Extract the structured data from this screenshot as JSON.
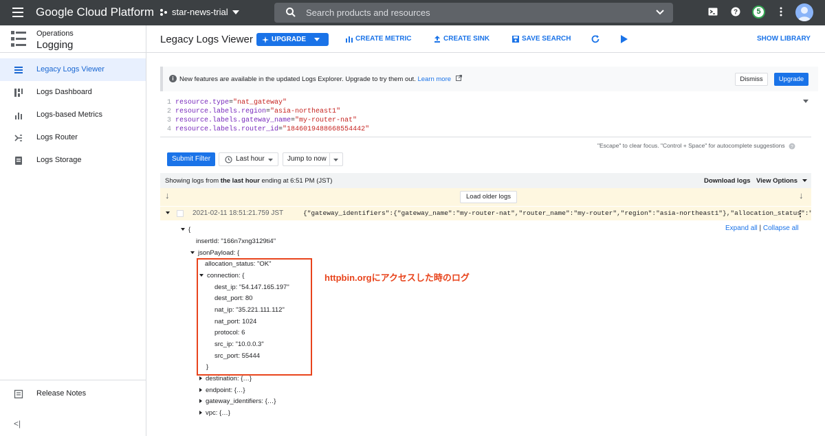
{
  "topbar": {
    "brand": "Google Cloud Platform",
    "project": "star-news-trial",
    "search_placeholder": "Search products and resources",
    "notification_count": "5"
  },
  "sidebar": {
    "section_sub": "Operations",
    "section_title": "Logging",
    "items": [
      {
        "label": "Legacy Logs Viewer",
        "icon": "list-icon",
        "active": true
      },
      {
        "label": "Logs Dashboard",
        "icon": "dashboard-icon",
        "active": false
      },
      {
        "label": "Logs-based Metrics",
        "icon": "bar-chart-icon",
        "active": false
      },
      {
        "label": "Logs Router",
        "icon": "router-icon",
        "active": false
      },
      {
        "label": "Logs Storage",
        "icon": "storage-icon",
        "active": false
      }
    ],
    "release_notes": "Release Notes",
    "collapse": "<|"
  },
  "toolbar": {
    "title": "Legacy Logs Viewer",
    "upgrade": "UPGRADE",
    "create_metric": "CREATE METRIC",
    "create_sink": "CREATE SINK",
    "save_search": "SAVE SEARCH",
    "show_library": "SHOW LIBRARY"
  },
  "banner": {
    "text": "New features are available in the updated Logs Explorer. Upgrade to try them out.",
    "link": "Learn more",
    "dismiss": "Dismiss",
    "upgrade": "Upgrade"
  },
  "query": {
    "lines": [
      {
        "num": "1",
        "key": "resource.type",
        "value": "\"nat_gateway\""
      },
      {
        "num": "2",
        "key": "resource.labels.region",
        "value": "\"asia-northeast1\""
      },
      {
        "num": "3",
        "key": "resource.labels.gateway_name",
        "value": "\"my-router-nat\""
      },
      {
        "num": "4",
        "key": "resource.labels.router_id",
        "value": "\"1846019488668554442\""
      }
    ],
    "hint": "\"Escape\" to clear focus. \"Control + Space\" for autocomplete suggestions"
  },
  "controls": {
    "submit": "Submit Filter",
    "time_range": "Last hour",
    "jump": "Jump to now"
  },
  "status": {
    "prefix": "Showing logs from ",
    "bold": "the last hour",
    "suffix": " ending at 6:51 PM (JST)",
    "download": "Download logs",
    "view_options": "View Options"
  },
  "older": {
    "load_older": "Load older logs"
  },
  "entry": {
    "timestamp": "2021-02-11 18:51:21.759 JST",
    "summary": "{\"gateway_identifiers\":{\"gateway_name\":\"my-router-nat\",\"router_name\":\"my-router\",\"region\":\"asia-northeast1\"},\"allocation_status\":\"OK\",\"e…"
  },
  "detail": {
    "expand_all": "Expand all",
    "collapse_all": "Collapse all",
    "open_brace": "{",
    "insert_id": "insertId: \"166n7xng3129ti4\"",
    "json_payload": "jsonPayload: {",
    "allocation_status": "allocation_status: \"OK\"",
    "connection": "connection: {",
    "fields": [
      "dest_ip: \"54.147.165.197\"",
      "dest_port: 80",
      "nat_ip: \"35.221.111.112\"",
      "nat_port: 1024",
      "protocol: 6",
      "src_ip: \"10.0.0.3\"",
      "src_port: 55444"
    ],
    "close_brace": "}",
    "destination": "destination: {…}",
    "endpoint": "endpoint: {…}",
    "gateway_identifiers": "gateway_identifiers: {…}",
    "vpc": "vpc: {…}"
  },
  "annotation": "httpbin.orgにアクセスした時のログ",
  "colors": {
    "accent": "#1a73e8",
    "highlight": "#e8431b",
    "topbar": "#3c4043"
  }
}
